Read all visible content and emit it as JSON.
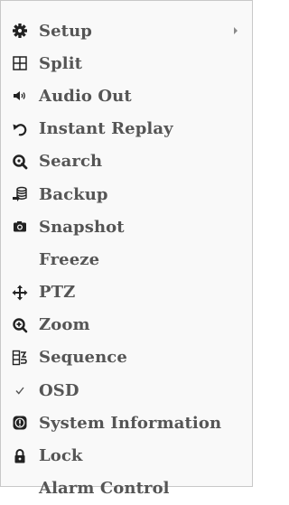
{
  "menu": {
    "items": [
      {
        "label": "Setup",
        "icon": "gear-icon",
        "has_submenu": true
      },
      {
        "label": "Split",
        "icon": "split-grid-icon"
      },
      {
        "label": "Audio Out",
        "icon": "speaker-icon"
      },
      {
        "label": "Instant Replay",
        "icon": "replay-icon"
      },
      {
        "label": "Search",
        "icon": "search-icon"
      },
      {
        "label": "Backup",
        "icon": "backup-icon"
      },
      {
        "label": "Snapshot",
        "icon": "camera-icon"
      },
      {
        "label": "Freeze",
        "icon": ""
      },
      {
        "label": "PTZ",
        "icon": "ptz-move-icon"
      },
      {
        "label": "Zoom",
        "icon": "zoom-icon"
      },
      {
        "label": "Sequence",
        "icon": "sequence-icon"
      },
      {
        "label": "OSD",
        "icon": "checkmark-icon"
      },
      {
        "label": "System Information",
        "icon": "alert-icon"
      },
      {
        "label": "Lock",
        "icon": "lock-icon"
      },
      {
        "label": "Alarm Control",
        "icon": ""
      }
    ]
  },
  "colors": {
    "menu_background": "#f9f9f9",
    "menu_border": "#c8c8c8",
    "text": "#555555",
    "icon": "#222222"
  }
}
